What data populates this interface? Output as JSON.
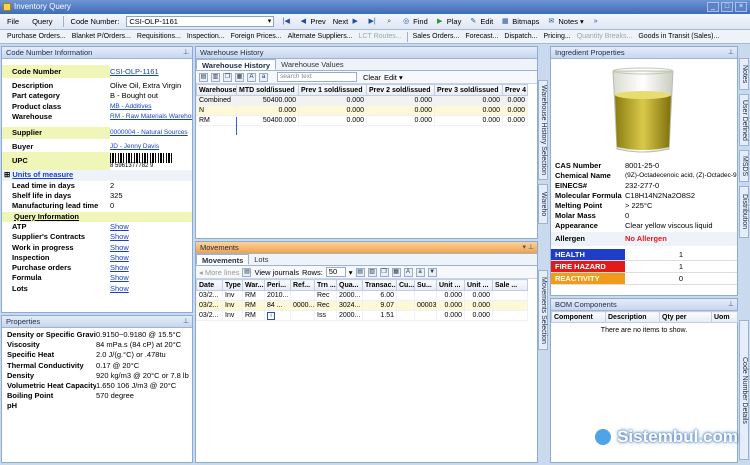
{
  "window": {
    "title": "Inventory Query"
  },
  "menu": {
    "file": "File",
    "query": "Query"
  },
  "toolbar": {
    "code_number_label": "Code Number:",
    "code_number_value": "CSI-OLP-1161",
    "prev": "Prev",
    "next": "Next",
    "find": "Find",
    "play": "Play",
    "edit": "Edit",
    "bitmaps": "Bitmaps",
    "notes": "Notes"
  },
  "links_bar": [
    {
      "label": "Purchase Orders...",
      "enabled": true
    },
    {
      "label": "Blanket P/Orders...",
      "enabled": true
    },
    {
      "label": "Requisitions...",
      "enabled": true
    },
    {
      "label": "Inspection...",
      "enabled": true
    },
    {
      "label": "Foreign Prices...",
      "enabled": true
    },
    {
      "label": "Alternate Suppliers...",
      "enabled": true
    },
    {
      "label": "LCT Routes...",
      "enabled": false
    },
    {
      "label": "Sales Orders...",
      "enabled": true
    },
    {
      "label": "Forecast...",
      "enabled": true
    },
    {
      "label": "Dispatch...",
      "enabled": true
    },
    {
      "label": "Pricing...",
      "enabled": true
    },
    {
      "label": "Quantity Breaks...",
      "enabled": false
    },
    {
      "label": "Goods in Transit (Sales)...",
      "enabled": true
    }
  ],
  "code_info": {
    "title": "Code Number Information",
    "code_number": {
      "label": "Code Number",
      "value": "CSI-OLP-1161"
    },
    "description": {
      "label": "Description",
      "value": "Olive Oil, Extra Virgin"
    },
    "part_category": {
      "label": "Part category",
      "value": "B - Bought out"
    },
    "product_class": {
      "label": "Product class",
      "value": "MB - Additives"
    },
    "warehouse": {
      "label": "Warehouse",
      "value": "RM - Raw Materials Warehouse"
    },
    "supplier": {
      "label": "Supplier",
      "value": "0000004 - Natural Sources"
    },
    "buyer": {
      "label": "Buyer",
      "value": "JD - Jenny Davis"
    },
    "upc": {
      "label": "UPC",
      "value": "8 5961377782 9"
    },
    "units_header": "Units of measure",
    "lead_time": {
      "label": "Lead time in days",
      "value": "2"
    },
    "shelf_life": {
      "label": "Shelf life in days",
      "value": "325"
    },
    "mfg_lead_time": {
      "label": "Manufacturing lead time",
      "value": "0"
    },
    "query_header": "Query Information",
    "show": "Show",
    "query_rows": [
      "ATP",
      "Supplier's Contracts",
      "Work in progress",
      "Inspection",
      "Purchase orders",
      "Formula",
      "Lots"
    ]
  },
  "properties": {
    "title": "Properties",
    "rows": [
      {
        "label": "Density or Specific Gravity",
        "value": "0.9150~0.9180 @ 15.5°C"
      },
      {
        "label": "Viscosity",
        "value": "84 mPa.s (84 cP) at 20°C"
      },
      {
        "label": "Specific Heat",
        "value": "2.0 J/(g.°C) or .478tu"
      },
      {
        "label": "Thermal Conductivity",
        "value": "0.17 @ 20°C"
      },
      {
        "label": "Density",
        "value": "920 kg/m3 @ 20°C or 7.8 lb"
      },
      {
        "label": "Volumetric Heat Capacity",
        "value": "1.650 106 J/m3 @ 20°C"
      },
      {
        "label": "Boiling Point",
        "value": "570 degree"
      },
      {
        "label": "pH",
        "value": ""
      }
    ]
  },
  "warehouse_history": {
    "title": "Warehouse History",
    "tabs": [
      "Warehouse History",
      "Warehouse Values"
    ],
    "search_placeholder": "search text",
    "clear": "Clear",
    "edit": "Edit",
    "columns": [
      "Warehouse",
      "MTD sold/issued",
      "Prev 1 sold/issued",
      "Prev 2 sold/issued",
      "Prev 3 sold/issued",
      "Prev 4"
    ],
    "rows": [
      [
        "Combined",
        "50400.000",
        "0.000",
        "0.000",
        "0.000",
        "0.000"
      ],
      [
        "N",
        "0.000",
        "0.000",
        "0.000",
        "0.000",
        "0.000"
      ],
      [
        "RM",
        "50400.000",
        "0.000",
        "0.000",
        "0.000",
        "0.000"
      ]
    ],
    "side_tabs": [
      "Warehouse History Selection",
      "Wareho"
    ]
  },
  "movements": {
    "title": "Movements",
    "tabs": [
      "Movements",
      "Lots"
    ],
    "more_lines": "More lines",
    "view_journals": "View journals",
    "rows_label": "Rows:",
    "rows_value": "50",
    "columns": [
      "Date",
      "Type",
      "War...",
      "Peri...",
      "Ref...",
      "Trn ...",
      "Qua...",
      "Transac...",
      "Cu...",
      "Su...",
      "Unit ...",
      "Unit ...",
      "Sale ..."
    ],
    "rows": [
      [
        "03/2...",
        "Inv",
        "RM",
        "2010...",
        "",
        "Rec",
        "2000...",
        "6.00",
        "",
        "",
        "0.000",
        "0.000",
        ""
      ],
      [
        "03/2...",
        "Inv",
        "RM",
        "84 ...",
        "0000...",
        "Rec",
        "3024...",
        "9.07",
        "",
        "00003",
        "0.000",
        "0.000",
        ""
      ],
      [
        "03/2...",
        "Inv",
        "RM",
        "i",
        "",
        "Iss",
        "2000...",
        "1.51",
        "",
        "",
        "0.000",
        "0.000",
        ""
      ]
    ],
    "side_tab": "Movements Selection"
  },
  "ingredient": {
    "title": "Ingredient Properties",
    "rows": [
      {
        "label": "CAS Number",
        "value": "8001-25-0"
      },
      {
        "label": "Chemical Name",
        "value": "(9Z)-Octadecenoic acid, (Z)-Octadec-9-enyl"
      },
      {
        "label": "EINECS#",
        "value": "232-277-0"
      },
      {
        "label": "Molecular Formula",
        "value": "C18H14N2Na2O8S2"
      },
      {
        "label": "Melting Point",
        "value": "> 225°C"
      },
      {
        "label": "Molar Mass",
        "value": "0"
      },
      {
        "label": "Appearance",
        "value": "Clear yellow viscous liquid"
      }
    ],
    "allergen": {
      "label": "Allergen",
      "value": "No Allergen"
    },
    "hazards": [
      {
        "label": "HEALTH",
        "value": "1",
        "color": "#1f3ec7"
      },
      {
        "label": "FIRE HAZARD",
        "value": "1",
        "color": "#e01b1b"
      },
      {
        "label": "REACTIVITY",
        "value": "0",
        "color": "#f29b1a"
      }
    ]
  },
  "bom": {
    "title": "BOM Components",
    "columns": [
      "Component",
      "Description",
      "Qty per",
      "Uom"
    ],
    "empty": "There are no items to show."
  },
  "right_tabs": [
    "Notes",
    "User Defined",
    "MSDS",
    "Distribution",
    "Code Number Details"
  ],
  "watermark": "Sistembul.com"
}
